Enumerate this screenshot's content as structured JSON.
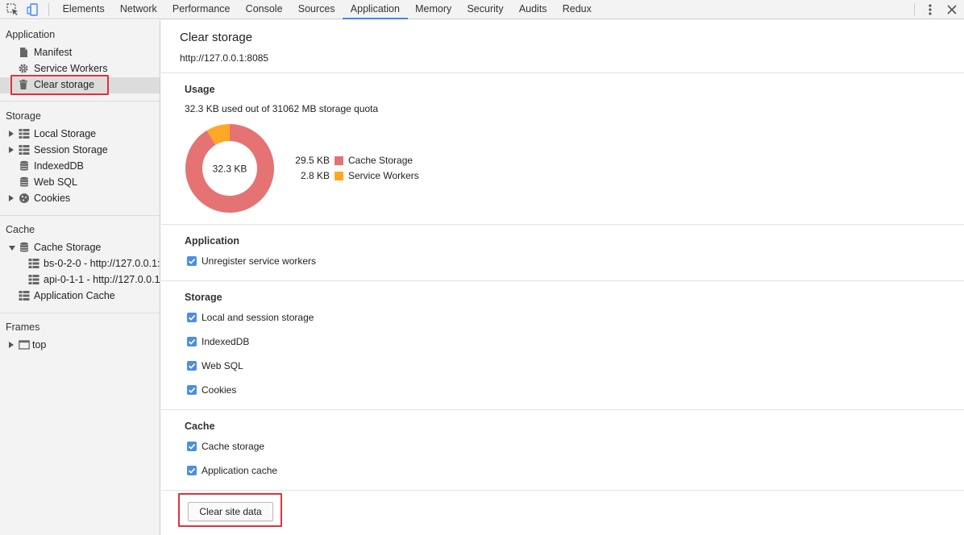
{
  "tabs": [
    "Elements",
    "Network",
    "Performance",
    "Console",
    "Sources",
    "Application",
    "Memory",
    "Security",
    "Audits",
    "Redux"
  ],
  "active_tab": "Application",
  "sidebar": {
    "application": {
      "title": "Application",
      "items": [
        {
          "label": "Manifest",
          "icon": "manifest-icon"
        },
        {
          "label": "Service Workers",
          "icon": "gear-icon"
        },
        {
          "label": "Clear storage",
          "icon": "trash-icon"
        }
      ]
    },
    "storage": {
      "title": "Storage",
      "items": [
        {
          "label": "Local Storage",
          "icon": "grid-icon"
        },
        {
          "label": "Session Storage",
          "icon": "grid-icon"
        },
        {
          "label": "IndexedDB",
          "icon": "database-icon"
        },
        {
          "label": "Web SQL",
          "icon": "database-icon"
        },
        {
          "label": "Cookies",
          "icon": "cookie-icon"
        }
      ]
    },
    "cache": {
      "title": "Cache",
      "items": [
        {
          "label": "Cache Storage",
          "icon": "database-icon"
        },
        {
          "label": "bs-0-2-0 - http://127.0.0.1:",
          "icon": "grid-icon"
        },
        {
          "label": "api-0-1-1 - http://127.0.0.1",
          "icon": "grid-icon"
        },
        {
          "label": "Application Cache",
          "icon": "grid-icon"
        }
      ]
    },
    "frames": {
      "title": "Frames",
      "items": [
        {
          "label": "top",
          "icon": "frame-icon"
        }
      ]
    }
  },
  "main": {
    "title": "Clear storage",
    "origin": "http://127.0.0.1:8085",
    "usage": {
      "title": "Usage",
      "summary": "32.3 KB used out of 31062 MB storage quota",
      "total_label": "32.3 KB",
      "breakdown": [
        {
          "value": "29.5 KB",
          "name": "Cache Storage",
          "color": "#e57373",
          "kb": 29.5
        },
        {
          "value": "2.8 KB",
          "name": "Service Workers",
          "color": "#ffa726",
          "kb": 2.8
        }
      ]
    },
    "sections": {
      "application": {
        "title": "Application",
        "options": [
          "Unregister service workers"
        ]
      },
      "storage": {
        "title": "Storage",
        "options": [
          "Local and session storage",
          "IndexedDB",
          "Web SQL",
          "Cookies"
        ]
      },
      "cache": {
        "title": "Cache",
        "options": [
          "Cache storage",
          "Application cache"
        ]
      }
    },
    "clear_button": "Clear site data"
  },
  "colors": {
    "accent": "#4285f4",
    "checkbox": "#4a8fe2",
    "highlight": "#e2303d"
  }
}
